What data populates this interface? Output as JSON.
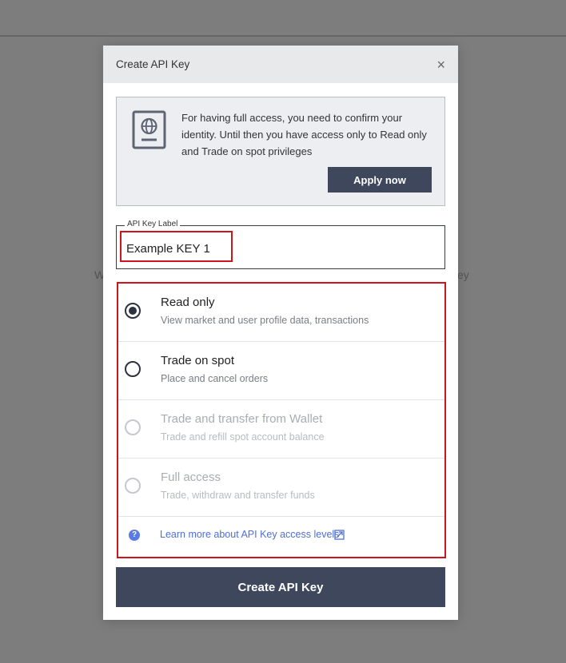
{
  "background": {
    "left_fragment": "We",
    "right_fragment": "ey"
  },
  "modal": {
    "title": "Create API Key",
    "close_glyph": "×"
  },
  "notice": {
    "icon": "passport-icon",
    "text": "For having full access, you need to confirm your identity. Until then you have access only to Read only and Trade on spot privileges",
    "apply_label": "Apply now"
  },
  "api_key_field": {
    "label": "API Key Label",
    "value": "Example KEY 1"
  },
  "options": [
    {
      "title": "Read only",
      "description": "View market and user profile data, transactions",
      "state": "selected"
    },
    {
      "title": "Trade on spot",
      "description": "Place and cancel orders",
      "state": "unselected"
    },
    {
      "title": "Trade and transfer from Wallet",
      "description": "Trade and refill spot account balance",
      "state": "disabled"
    },
    {
      "title": "Full access",
      "description": "Trade, withdraw and transfer funds",
      "state": "disabled"
    }
  ],
  "learn_more": {
    "help_glyph": "?",
    "label": "Learn more about API Key access levels",
    "icon": "external-link-icon"
  },
  "create_button": {
    "label": "Create API Key"
  },
  "colors": {
    "primary_dark": "#3f475c",
    "highlight_red": "#d0141c",
    "link_blue": "#4f6fd3"
  }
}
